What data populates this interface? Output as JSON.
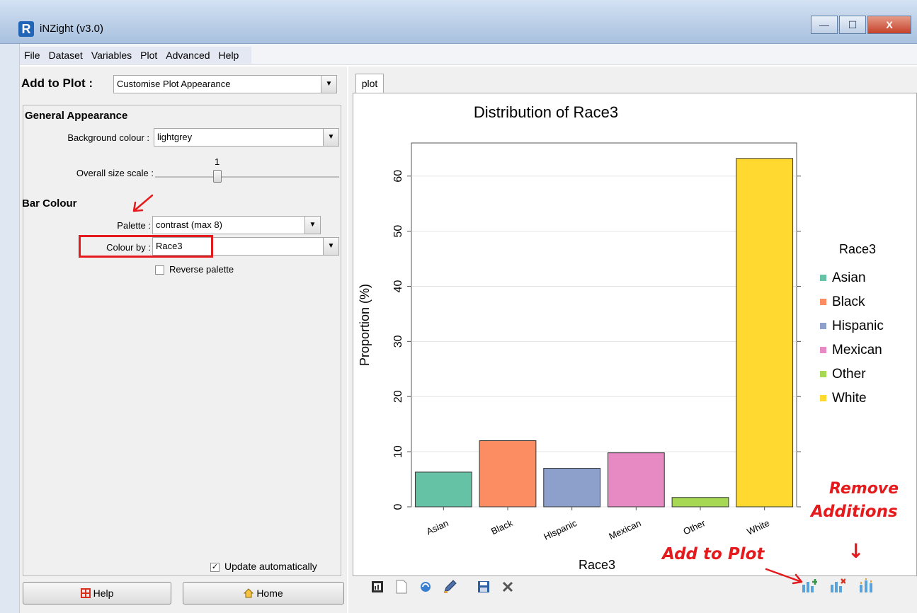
{
  "window": {
    "title": "iNZight (v3.0)",
    "icon_letter": "R",
    "minimize_glyph": "—",
    "maximize_glyph": "☐",
    "close_glyph": "X"
  },
  "menu": [
    "File",
    "Dataset",
    "Variables",
    "Plot",
    "Advanced",
    "Help"
  ],
  "left": {
    "add_to_plot_label": "Add to Plot :",
    "add_to_plot_value": "Customise Plot Appearance",
    "general_appearance_title": "General Appearance",
    "background_label": "Background colour :",
    "background_value": "lightgrey",
    "size_scale_label": "Overall size scale :",
    "size_scale_value": "1",
    "bar_colour_title": "Bar Colour",
    "palette_label": "Palette :",
    "palette_value": "contrast (max 8)",
    "colour_by_label": "Colour by :",
    "colour_by_value": "Race3",
    "reverse_palette_label": "Reverse palette",
    "reverse_palette_checked": false,
    "update_auto_label": "Update automatically",
    "update_auto_checked": true,
    "help_button": "Help",
    "home_button": "Home"
  },
  "right": {
    "tab_label": "plot",
    "toolbar_icons": [
      "new-plot-icon",
      "blank-page-icon",
      "refresh-icon",
      "edit-icon",
      "save-icon",
      "close-icon"
    ],
    "bottom_icons": [
      "add-to-plot-icon",
      "remove-additions-icon",
      "inference-icon"
    ]
  },
  "annotations": {
    "add_to_plot_text": "Add to Plot",
    "remove_additions_line1": "Remove",
    "remove_additions_line2": "Additions",
    "arrow_down": "↓"
  },
  "chart_data": {
    "type": "bar",
    "title": "Distribution of Race3",
    "xlabel": "Race3",
    "ylabel": "Proportion (%)",
    "categories": [
      "Asian",
      "Black",
      "Hispanic",
      "Mexican",
      "Other",
      "White"
    ],
    "values": [
      6.3,
      12.0,
      7.0,
      9.8,
      1.7,
      63.2
    ],
    "colors": [
      "#66c2a5",
      "#fc8d62",
      "#8da0cb",
      "#e78ac3",
      "#a6d854",
      "#ffd92f"
    ],
    "ylim": [
      0,
      66
    ],
    "yticks": [
      0,
      10,
      20,
      30,
      40,
      50,
      60
    ],
    "legend_title": "Race3",
    "legend_position": "right",
    "grid": true
  }
}
